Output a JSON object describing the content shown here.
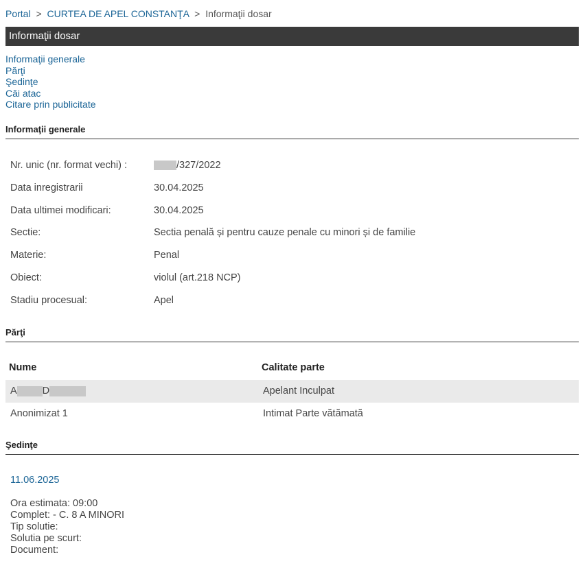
{
  "breadcrumb": {
    "items": [
      "Portal",
      "CURTEA DE APEL CONSTANŢA"
    ],
    "current": "Informaţii dosar",
    "separator": ">"
  },
  "title_bar": {
    "title": "Informaţii dosar",
    "color": "#3a3a3a"
  },
  "nav_links": [
    "Informaţii generale",
    "Părţi",
    "Şedinţe",
    "Căi atac",
    "Citare prin publicitate"
  ],
  "sections": {
    "general": "Informaţii generale",
    "parties": "Părţi",
    "sessions": "Şedinţe"
  },
  "general_info": [
    {
      "label": "Nr. unic (nr. format vechi) :",
      "value": "/327/2022",
      "redacted_prefix": true
    },
    {
      "label": "Data inregistrarii",
      "value": "30.04.2025"
    },
    {
      "label": "Data ultimei modificari:",
      "value": "30.04.2025"
    },
    {
      "label": "Sectie:",
      "value": "Sectia penală și pentru cauze penale cu minori și de familie"
    },
    {
      "label": "Materie:",
      "value": "Penal"
    },
    {
      "label": "Obiect:",
      "value": "violul (art.218 NCP)"
    },
    {
      "label": "Stadiu procesual:",
      "value": "Apel"
    }
  ],
  "parties_table": {
    "headers": [
      "Nume",
      "Calitate parte"
    ],
    "rows": [
      {
        "name_initials": [
          "A",
          "D"
        ],
        "redacted": true,
        "role": "Apelant Inculpat"
      },
      {
        "name": "Anonimizat 1",
        "role": "Intimat Parte vătămată"
      }
    ]
  },
  "session": {
    "date": "11.06.2025",
    "details": [
      "Ora estimata: 09:00",
      "Complet: - C. 8 A MINORI",
      "Tip solutie:",
      "Solutia pe scurt:",
      "Document:"
    ]
  },
  "colors": {
    "link": "#1a6496",
    "row_shade": "#eaeaea",
    "redaction": "#c8c8c8"
  }
}
